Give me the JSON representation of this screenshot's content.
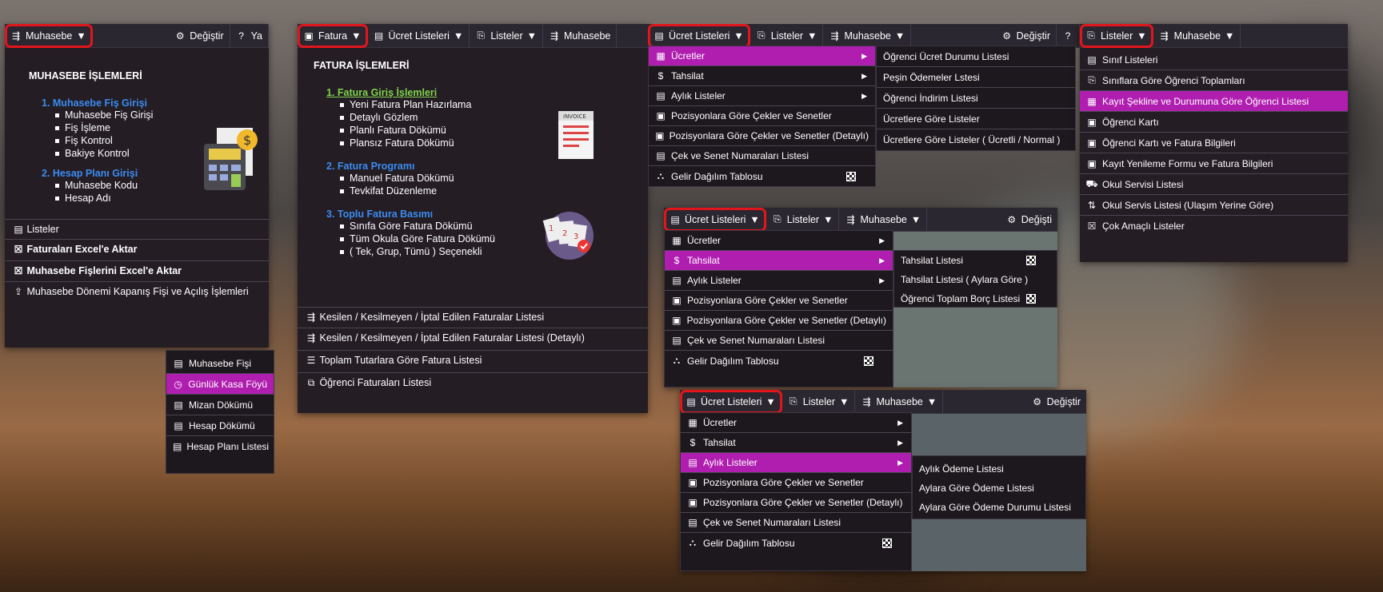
{
  "mu": {
    "bar": [
      "Muhasebe",
      "Değiştir",
      "Ya"
    ],
    "title": "MUHASEBE İŞLEMLERİ",
    "g1": "1. Muhasebe Fiş Girişi",
    "g1i": [
      "Muhasebe Fiş Girişi",
      "Fiş İşleme",
      "Fiş Kontrol",
      "Bakiye Kontrol"
    ],
    "g2": "2. Hesap Planı Girişi",
    "g2i": [
      "Muhasebe Kodu",
      "Hesap Adı"
    ],
    "bottom": [
      "Listeler",
      "Faturaları Excel'e Aktar",
      "Muhasebe Fişlerini Excel'e Aktar",
      "Muhasebe Dönemi Kapanış Fişi ve Açılış İşlemleri"
    ]
  },
  "ml": {
    "items": [
      "Muhasebe Fişi",
      "Günlük Kasa Föyü",
      "Mizan Dökümü",
      "Hesap Dökümü",
      "Hesap Planı Listesi"
    ]
  },
  "fa": {
    "bar": [
      "Fatura",
      "Ücret Listeleri",
      "Listeler",
      "Muhasebe"
    ],
    "title": "FATURA İŞLEMLERİ",
    "g1": "1. Fatura Giriş İşlemleri",
    "g1i": [
      "Yeni Fatura Plan Hazırlama",
      "Detaylı Gözlem",
      "Planlı Fatura Dökümü",
      "Plansız Fatura Dökümü"
    ],
    "g2": "2. Fatura Programı",
    "g2i": [
      "Manuel Fatura Dökümü",
      "Tevkifat Düzenleme"
    ],
    "g3": "3. Toplu Fatura Basımı",
    "g3i": [
      "Sınıfa Göre Fatura Dökümü",
      "Tüm Okula Göre Fatura Dökümü",
      "( Tek, Grup, Tümü ) Seçenekli"
    ],
    "invoice": "INVOICE",
    "bottom": [
      "Kesilen / Kesilmeyen / İptal Edilen Faturalar Listesi",
      "Kesilen / Kesilmeyen / İptal Edilen Faturalar Listesi (Detaylı)",
      "Toplam Tutarlara Göre Fatura Listesi",
      "Öğrenci Faturaları Listesi"
    ]
  },
  "ucret_menu": [
    "Ücretler",
    "Tahsilat",
    "Aylık Listeler",
    "Pozisyonlara Göre Çekler ve Senetler",
    "Pozisyonlara Göre Çekler ve Senetler (Detaylı)",
    "Çek ve Senet Numaraları Listesi",
    "Gelir Dağılım Tablosu"
  ],
  "u1": {
    "bar": [
      "Ücret Listeleri",
      "Listeler",
      "Muhasebe",
      "Değiştir"
    ],
    "sub": [
      "Öğrenci Ücret Durumu Listesi",
      "Peşin Ödemeler Lstesi",
      "Öğrenci İndirim Listesi",
      "Ücretlere Göre Listeler",
      "Ücretlere Göre Listeler ( Ücretli / Normal )"
    ]
  },
  "u2": {
    "bar": [
      "Ücret Listeleri",
      "Listeler",
      "Muhasebe",
      "Değişti"
    ],
    "sub": [
      "Tahsilat Listesi",
      "Tahsilat Listesi ( Aylara Göre )",
      "Öğrenci Toplam Borç Listesi"
    ]
  },
  "u3": {
    "bar": [
      "Ücret Listeleri",
      "Listeler",
      "Muhasebe",
      "Değiştir"
    ],
    "sub": [
      "Aylık Ödeme Listesi",
      "Aylara Göre Ödeme Listesi",
      "Aylara Göre Ödeme Durumu Listesi"
    ]
  },
  "li": {
    "bar": [
      "Listeler",
      "Muhasebe"
    ],
    "items": [
      "Sınıf Listeleri",
      "Sınıflara Göre Öğrenci Toplamları",
      "Kayıt Şekline ve Durumuna Göre Öğrenci Listesi",
      "Öğrenci Kartı",
      "Öğrenci Kartı ve Fatura Bilgileri",
      "Kayıt Yenileme Formu ve Fatura Bilgileri",
      "Okul Servisi Listesi",
      "Okul Servis Listesi (Ulaşım Yerine Göre)",
      "Çok Amaçlı Listeler"
    ]
  },
  "colors": {
    "accent": "#b01eb0",
    "highlight": "#e0161c",
    "link_blue": "#3b8cf0",
    "link_green": "#7fd34a"
  }
}
